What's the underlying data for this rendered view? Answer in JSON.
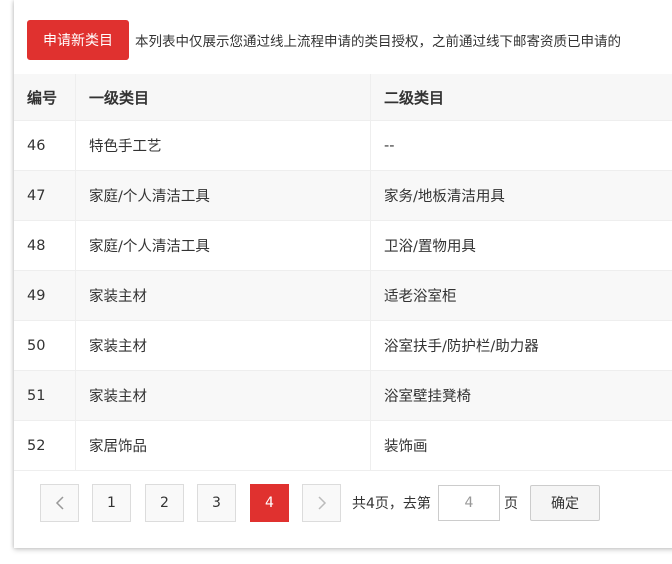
{
  "header": {
    "apply_button": "申请新类目",
    "notice": "本列表中仅展示您通过线上流程申请的类目授权，之前通过线下邮寄资质已申请的"
  },
  "table": {
    "columns": [
      "编号",
      "一级类目",
      "二级类目"
    ],
    "rows": [
      [
        "46",
        "特色手工艺",
        "--"
      ],
      [
        "47",
        "家庭/个人清洁工具",
        "家务/地板清洁用具"
      ],
      [
        "48",
        "家庭/个人清洁工具",
        "卫浴/置物用具"
      ],
      [
        "49",
        "家装主材",
        "适老浴室柜"
      ],
      [
        "50",
        "家装主材",
        "浴室扶手/防护栏/助力器"
      ],
      [
        "51",
        "家装主材",
        "浴室壁挂凳椅"
      ],
      [
        "52",
        "家居饰品",
        "装饰画"
      ]
    ]
  },
  "pagination": {
    "prev_icon": "chevron-left-icon",
    "next_icon": "chevron-right-icon",
    "pages": [
      "1",
      "2",
      "3",
      "4"
    ],
    "current_page": "4",
    "total_text": "共4页，去第",
    "goto_value": "4",
    "page_suffix": "页",
    "confirm_label": "确定"
  },
  "colors": {
    "accent": "#e0312f",
    "border": "#eeeeee",
    "text": "#333333"
  }
}
